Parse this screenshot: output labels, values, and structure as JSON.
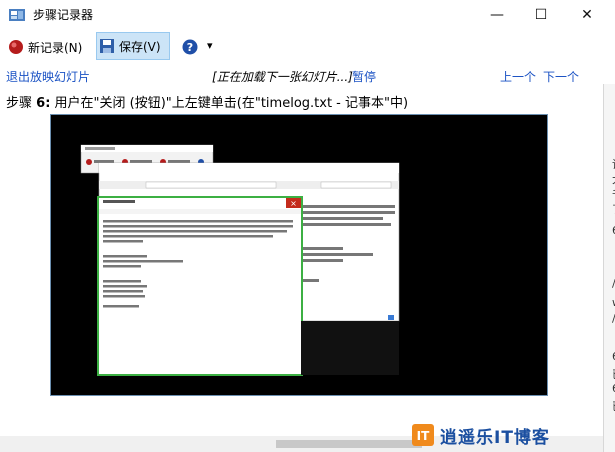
{
  "window": {
    "title": "步骤记录器",
    "minimize": "—",
    "maximize": "☐",
    "close": "✕"
  },
  "toolbar": {
    "new_record": "新记录(N)",
    "save": "保存(V)",
    "help": "?",
    "help_dropdown": "▾"
  },
  "nav": {
    "exit_slideshow": "退出放映幻灯片",
    "status_prefix": "[",
    "status": "正在加载下一张幻灯片...",
    "status_suffix": "]",
    "pause": "暂停",
    "prev": "上一个",
    "next": "下一个"
  },
  "step": {
    "label": "步骤",
    "number": "6:",
    "description": "用户在\"关闭 (按钮)\"上左键单击(在\"timelog.txt - 记事本\"中)"
  },
  "right_strip_chars": [
    "请",
    "大",
    "千",
    "了",
    "6",
    "/",
    "w",
    "/",
    "6",
    "已",
    "6",
    "已"
  ],
  "watermark": {
    "text": "逍遥乐IT博客",
    "logo_letter": "IT"
  },
  "colors": {
    "link": "#1a52c4",
    "highlight_green": "#3cb043",
    "close_red": "#c42b1c",
    "screenshot_bg": "#000000"
  }
}
